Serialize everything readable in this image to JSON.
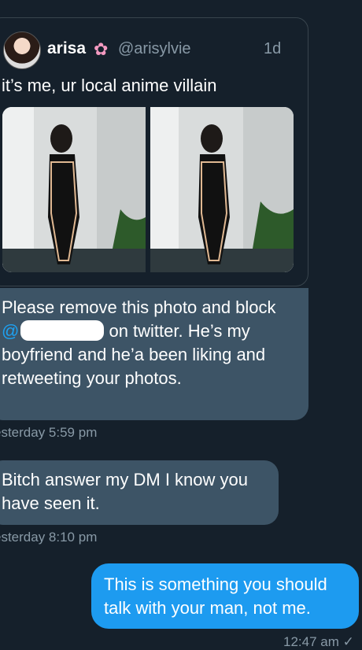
{
  "tweet": {
    "name": "arisa",
    "handle": "@arisylvie",
    "time": "1d",
    "text": "it’s me, ur local anime villain"
  },
  "messages": [
    {
      "text_before": "Please remove this photo and block ",
      "mention_start": "@",
      "text_after": " on twitter. He’s my boyfriend and he’a been liking and retweeting your photos.",
      "timestamp": "esterday 5:59 pm"
    },
    {
      "text": "Bitch answer my DM I know you have seen it.",
      "timestamp": "esterday 8:10 pm"
    },
    {
      "text": "This is something you should talk with your man, not me.",
      "timestamp": "12:47 am ✓"
    }
  ],
  "colors": {
    "background": "#15202b",
    "incoming": "#3d5466",
    "outgoing": "#1d9bf0"
  }
}
